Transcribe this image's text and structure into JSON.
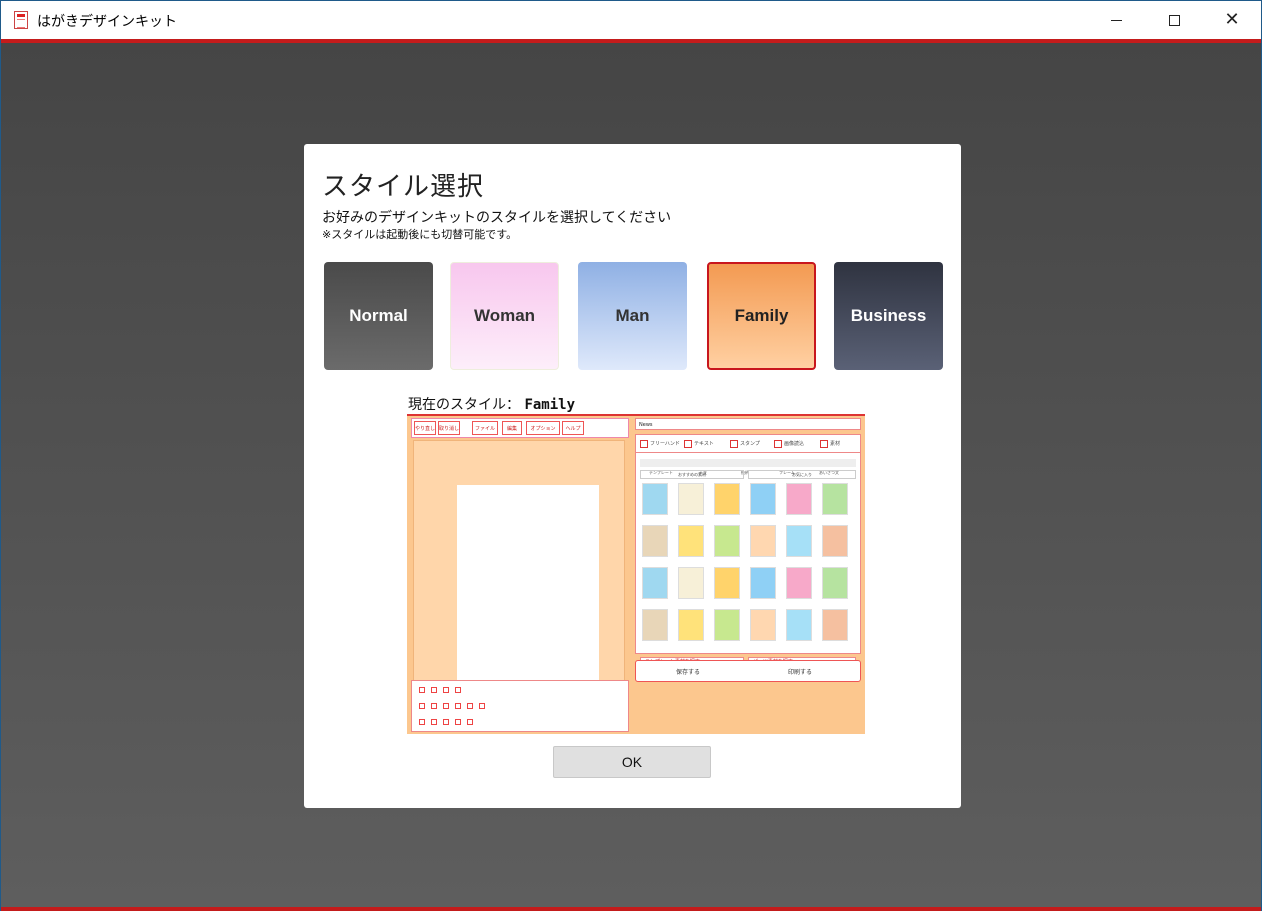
{
  "window": {
    "title": "はがきデザインキット",
    "icon": "postcard-app-icon"
  },
  "dialog": {
    "title": "スタイル選択",
    "subtitle": "お好みのデザインキットのスタイルを選択してください",
    "note": "※スタイルは起動後にも切替可能です。",
    "styles": [
      {
        "label": "Normal"
      },
      {
        "label": "Woman"
      },
      {
        "label": "Man"
      },
      {
        "label": "Family",
        "selected": true
      },
      {
        "label": "Business"
      }
    ],
    "current_style_label": "現在のスタイル：",
    "current_style_value": "Family",
    "ok_label": "OK"
  },
  "colors": {
    "accent_red": "#c41b1b",
    "family_orange": "#f39a52",
    "backdrop": "#4f4f4f"
  },
  "preview": {
    "tabs": [
      "やり直し",
      "取り消し",
      "ファイル",
      "編集",
      "オプション",
      "ヘルプ"
    ],
    "news_label": "News",
    "tools": [
      "フリーハンド",
      "テキスト",
      "スタンプ",
      "画像読込",
      "素材"
    ],
    "categories": [
      "テンプレート",
      "干支",
      "絵柄",
      "フレーム",
      "あいさつ文"
    ],
    "search_recommended": "おすすめの素材",
    "search_favorites": "お気に入り",
    "find_template": "テンプレート素材を探す",
    "find_parts": "パーツ素材を探す",
    "save_label": "保存する",
    "print_label": "印刷する"
  }
}
